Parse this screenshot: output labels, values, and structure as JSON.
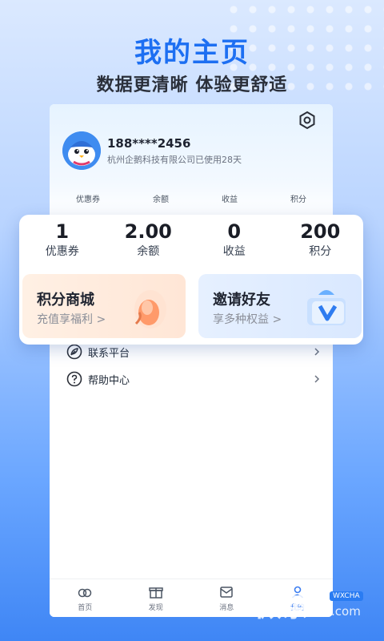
{
  "hero": {
    "title": "我的主页",
    "subtitle": "数据更清晰 体验更舒适"
  },
  "profile": {
    "phone": "188****2456",
    "company_line": "杭州企鹅科技有限公司已使用28天"
  },
  "mini_stats": [
    {
      "label": "优惠券"
    },
    {
      "label": "余额"
    },
    {
      "label": "收益"
    },
    {
      "label": "积分"
    }
  ],
  "stats": [
    {
      "value": "1",
      "label": "优惠券"
    },
    {
      "value": "2.00",
      "label": "余额"
    },
    {
      "value": "0",
      "label": "收益"
    },
    {
      "value": "200",
      "label": "积分"
    }
  ],
  "cards": {
    "mall": {
      "title": "积分商城",
      "subtitle": "充值享福利 >"
    },
    "invite": {
      "title": "邀请好友",
      "subtitle": "享多种权益 >"
    }
  },
  "menu": [
    {
      "label": "联系平台",
      "icon": "leaf-icon"
    },
    {
      "label": "帮助中心",
      "icon": "help-icon"
    }
  ],
  "tabbar": [
    {
      "label": "首页",
      "icon": "home-icon"
    },
    {
      "label": "发现",
      "icon": "gift-icon"
    },
    {
      "label": "消息",
      "icon": "message-icon"
    },
    {
      "label": "我的",
      "icon": "profile-icon",
      "active": true
    }
  ],
  "watermark": {
    "text": "微茶",
    "badge": "WXCHA",
    "domain": ".com"
  },
  "colors": {
    "accent": "#1d6ff2",
    "active_tab": "#3a7cf0"
  }
}
